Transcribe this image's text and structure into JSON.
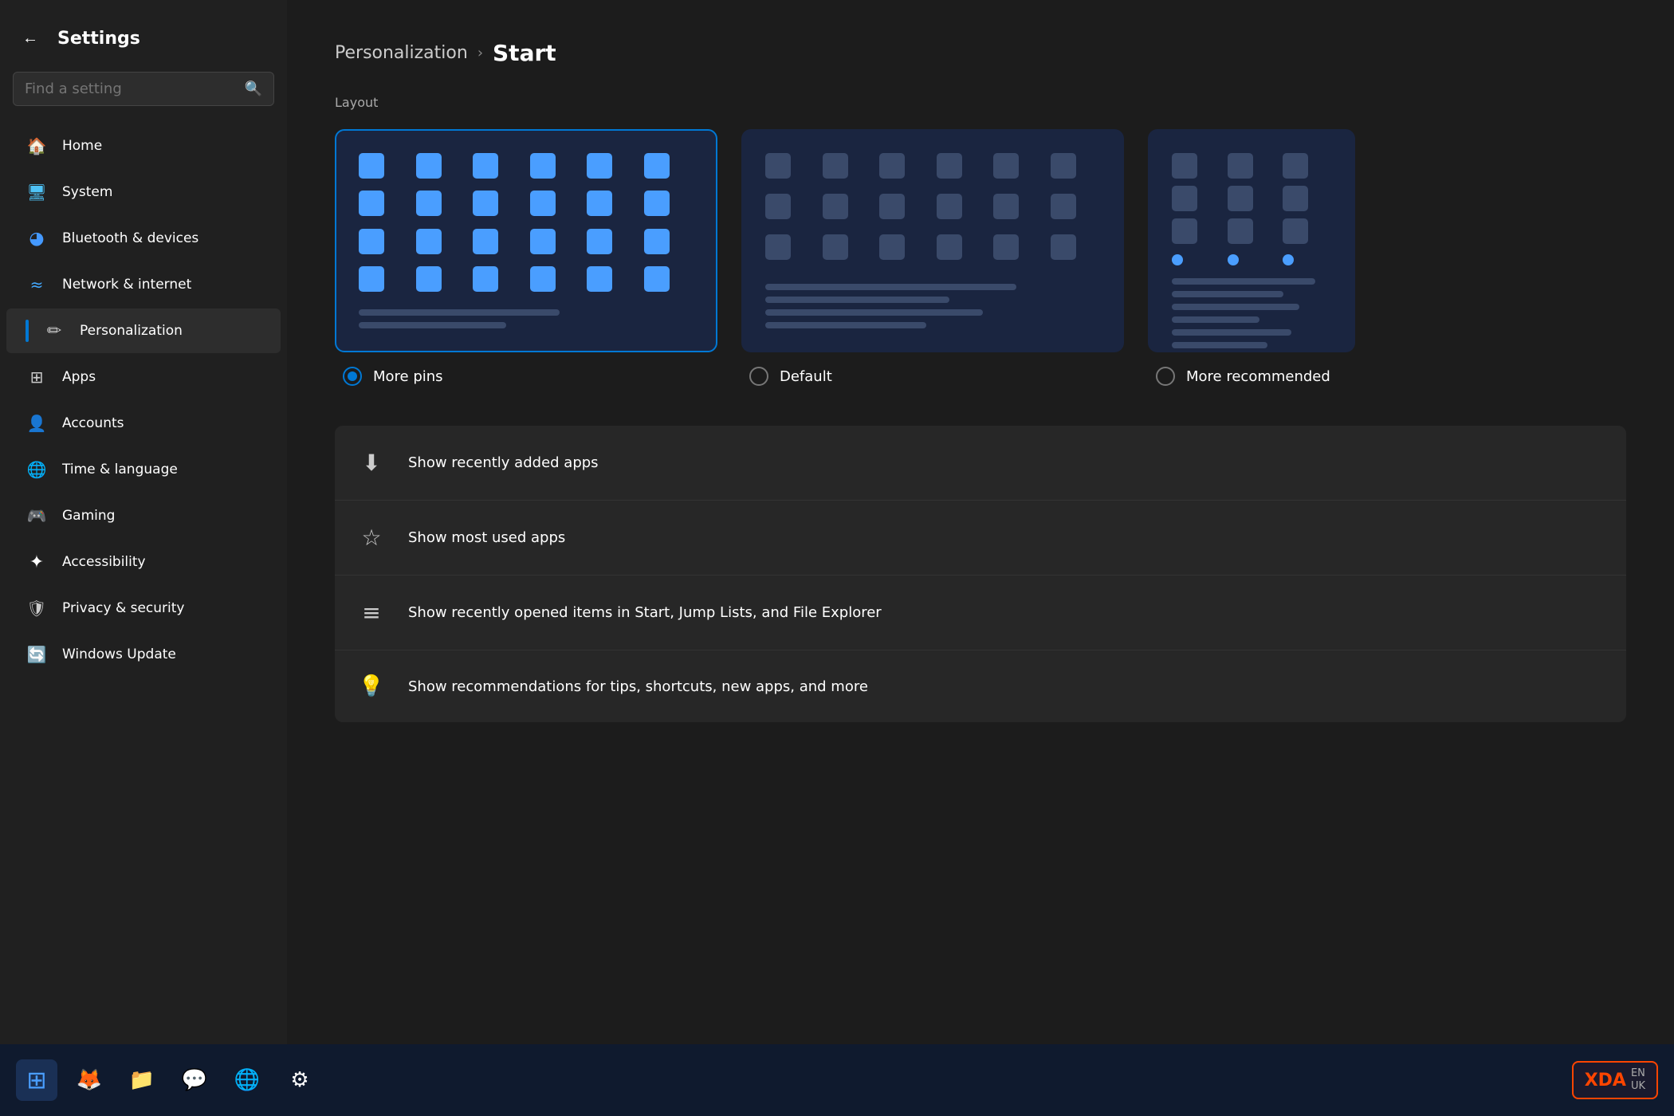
{
  "app": {
    "title": "Settings"
  },
  "sidebar": {
    "back_label": "←",
    "title": "Settings",
    "search_placeholder": "Find a setting",
    "nav_items": [
      {
        "id": "home",
        "label": "Home",
        "icon": "🏠",
        "icon_class": "icon-home",
        "active": false
      },
      {
        "id": "system",
        "label": "System",
        "icon": "💻",
        "icon_class": "icon-system",
        "active": false
      },
      {
        "id": "bluetooth",
        "label": "Bluetooth & devices",
        "icon": "◉",
        "icon_class": "icon-bluetooth",
        "active": false
      },
      {
        "id": "network",
        "label": "Network & internet",
        "icon": "≋",
        "icon_class": "icon-network",
        "active": false
      },
      {
        "id": "personalization",
        "label": "Personalization",
        "icon": "✏",
        "icon_class": "icon-personalization",
        "active": true
      },
      {
        "id": "apps",
        "label": "Apps",
        "icon": "⊞",
        "icon_class": "icon-apps",
        "active": false
      },
      {
        "id": "accounts",
        "label": "Accounts",
        "icon": "👤",
        "icon_class": "icon-accounts",
        "active": false
      },
      {
        "id": "time",
        "label": "Time & language",
        "icon": "🌐",
        "icon_class": "icon-time",
        "active": false
      },
      {
        "id": "gaming",
        "label": "Gaming",
        "icon": "🎮",
        "icon_class": "icon-gaming",
        "active": false
      },
      {
        "id": "accessibility",
        "label": "Accessibility",
        "icon": "♿",
        "icon_class": "icon-accessibility",
        "active": false
      },
      {
        "id": "privacy",
        "label": "Privacy & security",
        "icon": "🛡",
        "icon_class": "icon-privacy",
        "active": false
      },
      {
        "id": "update",
        "label": "Windows Update",
        "icon": "🔄",
        "icon_class": "icon-update",
        "active": false
      }
    ]
  },
  "main": {
    "breadcrumb_section": "Personalization",
    "breadcrumb_page": "Start",
    "section_label": "Layout",
    "layout_options": [
      {
        "id": "more-pins",
        "label": "More pins",
        "selected": true
      },
      {
        "id": "default",
        "label": "Default",
        "selected": false
      },
      {
        "id": "more-recommended",
        "label": "More recommended",
        "selected": false
      }
    ],
    "settings": [
      {
        "id": "recently-added",
        "icon": "⬇",
        "label": "Show recently added apps"
      },
      {
        "id": "most-used",
        "icon": "☆",
        "label": "Show most used apps"
      },
      {
        "id": "recently-opened",
        "icon": "≡",
        "label": "Show recently opened items in Start, Jump Lists, and File Explorer"
      },
      {
        "id": "recommendations",
        "icon": "💡",
        "label": "Show recommendations for tips, shortcuts, new apps, and more"
      }
    ]
  },
  "taskbar": {
    "icons": [
      {
        "id": "start",
        "emoji": "⊞",
        "label": "Start"
      },
      {
        "id": "foxpro",
        "emoji": "🦊",
        "label": "FoxPro"
      },
      {
        "id": "explorer",
        "emoji": "📁",
        "label": "File Explorer"
      },
      {
        "id": "discord",
        "emoji": "💬",
        "label": "Discord"
      },
      {
        "id": "chrome",
        "emoji": "🌐",
        "label": "Chrome"
      },
      {
        "id": "settings",
        "emoji": "⚙",
        "label": "Settings"
      }
    ],
    "xda_label": "XDA",
    "xda_sub": "EN\nUK"
  }
}
